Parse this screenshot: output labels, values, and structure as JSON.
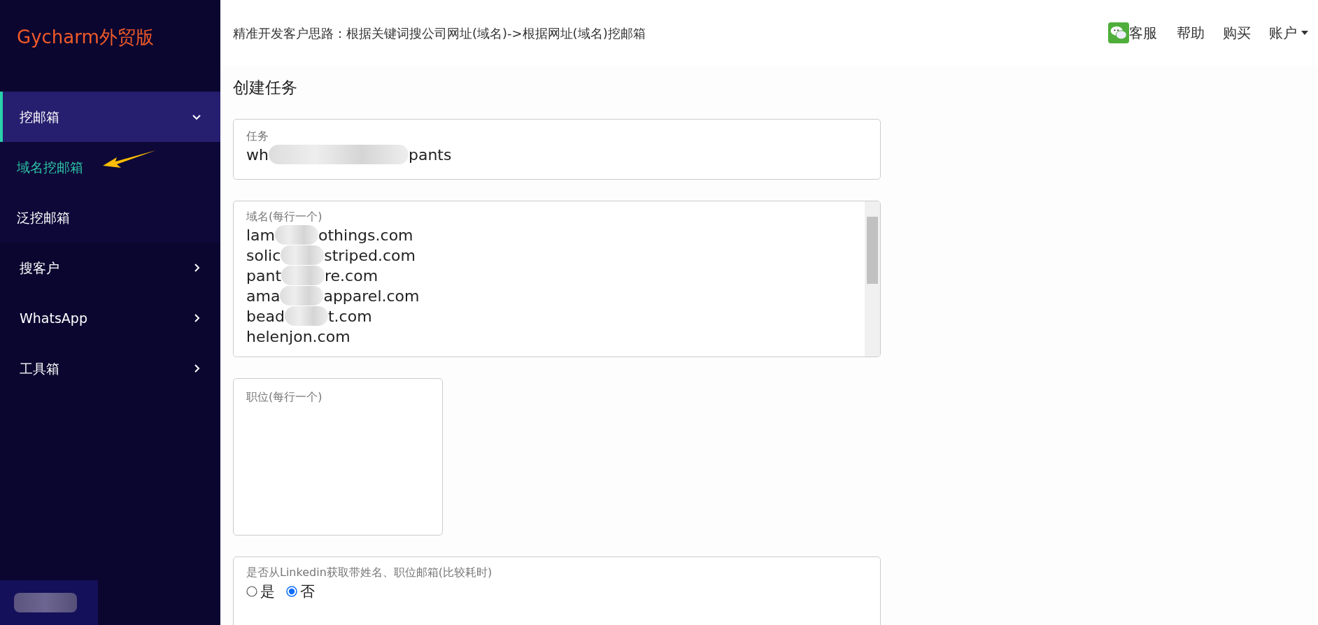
{
  "sidebar": {
    "logo": "Gycharm外贸版",
    "items": [
      {
        "label": "挖邮箱",
        "expanded": true,
        "selected": true,
        "children": [
          {
            "label": "域名挖邮箱",
            "selected": true
          },
          {
            "label": "泛挖邮箱",
            "selected": false
          }
        ]
      },
      {
        "label": "搜客户",
        "expanded": false,
        "selected": false
      },
      {
        "label": "WhatsApp",
        "expanded": false,
        "selected": false
      },
      {
        "label": "工具箱",
        "expanded": false,
        "selected": false
      }
    ]
  },
  "header": {
    "hint": "精准开发客户思路：根据关键词搜公司网址(域名)->根据网址(域名)挖邮箱",
    "links": [
      {
        "label": "客服",
        "kind": "chat"
      },
      {
        "label": "帮助",
        "kind": "plain"
      },
      {
        "label": "购买",
        "kind": "plain"
      },
      {
        "label": "账户",
        "kind": "dropdown"
      }
    ]
  },
  "form": {
    "title": "创建任务",
    "task_name": {
      "label": "任务",
      "value_parts": [
        "wh",
        "pants"
      ]
    },
    "domains": {
      "label": "域名(每行一个)",
      "lines": [
        [
          "lam",
          "othings.com"
        ],
        [
          "solic",
          "striped.com"
        ],
        [
          "pant",
          "re.com"
        ],
        [
          "ama",
          "apparel.com"
        ],
        [
          "bead",
          "t.com"
        ],
        [
          "helenjon.com"
        ]
      ]
    },
    "positions": {
      "label": "职位(每行一个)"
    },
    "linkedin": {
      "label": "是否从Linkedin获取带姓名、职位邮箱(比较耗时)",
      "options": [
        {
          "label": "是",
          "selected": false
        },
        {
          "label": "否",
          "selected": true
        }
      ]
    }
  }
}
